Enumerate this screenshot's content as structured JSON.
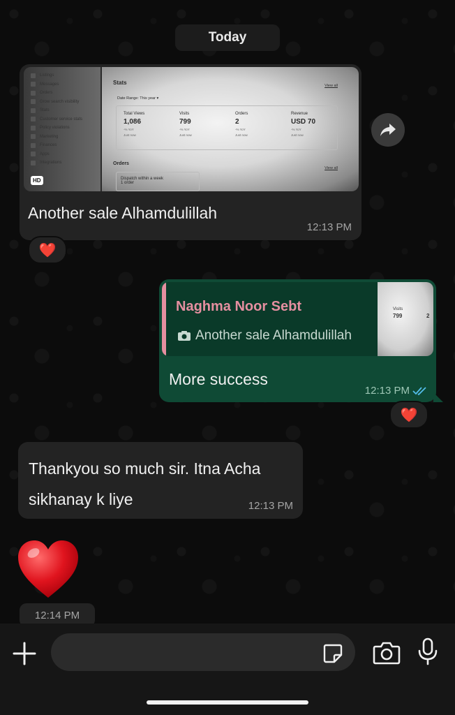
{
  "date_label": "Today",
  "messages": {
    "image_msg": {
      "caption": "Another sale Alhamdulillah",
      "time": "12:13 PM",
      "hd_badge": "HD",
      "reaction": "❤️",
      "screenshot": {
        "sidebar": [
          "Listings",
          "Messages",
          "Orders",
          "Grow search visibility",
          "Stats",
          "Customer service stats",
          "Policy violations",
          "Marketing",
          "Finances",
          "Apps",
          "Integrations"
        ],
        "title": "Stats",
        "date_range": "Date Range: This year ▾",
        "view_all": "View all",
        "stats": [
          {
            "label": "Total Views",
            "value": "1,086",
            "delta": "-% YoY",
            "note": "Just now"
          },
          {
            "label": "Visits",
            "value": "799",
            "delta": "-% YoY",
            "note": "Just now"
          },
          {
            "label": "Orders",
            "value": "2",
            "delta": "-% YoY",
            "note": "Just now"
          },
          {
            "label": "Revenue",
            "value": "USD 70",
            "delta": "-% YoY",
            "note": "Just now"
          }
        ],
        "orders_title": "Orders",
        "dispatch": "Dispatch within a week",
        "dispatch_count": "1 order"
      }
    },
    "reply_msg": {
      "quoted_name": "Naghma Noor Sebt",
      "quoted_text": "Another sale Alhamdulillah",
      "quoted_thumb_label": "Visits",
      "quoted_thumb_value": "799",
      "quoted_thumb_value2": "2",
      "text": "More success",
      "time": "12:13 PM",
      "reaction": "❤️"
    },
    "text_msg": {
      "line1": "Thankyou so much sir. Itna Acha",
      "line2": "sikhanay k liye",
      "time": "12:13 PM"
    },
    "heart_msg": {
      "time": "12:14 PM"
    }
  },
  "composer": {
    "placeholder": ""
  },
  "colors": {
    "incoming_bubble": "#232323",
    "outgoing_bubble": "#0f4a35",
    "quote_name": "#e58fa0",
    "read_ticks": "#53bdeb"
  }
}
